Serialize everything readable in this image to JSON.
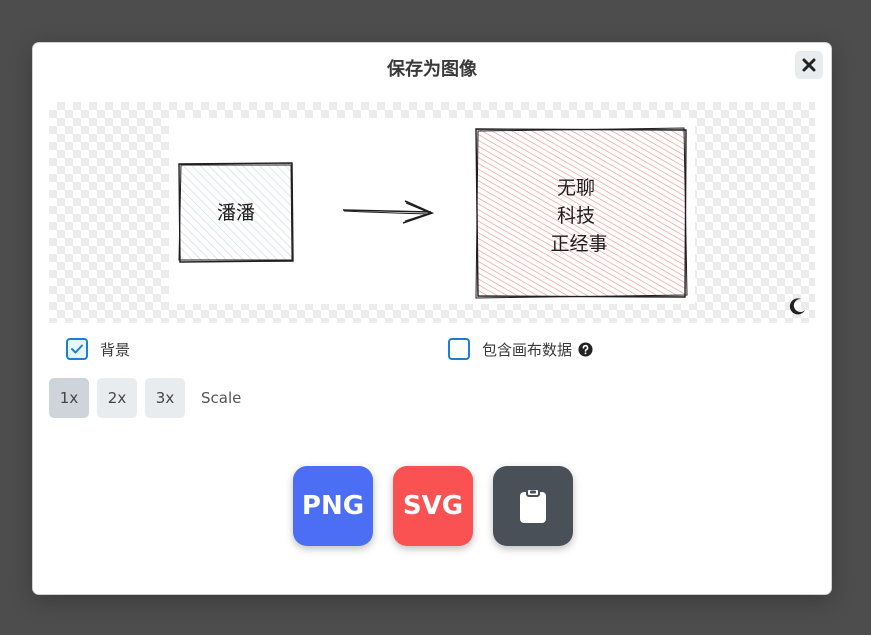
{
  "dialog": {
    "title": "保存为图像"
  },
  "canvas": {
    "left_box_text": "潘潘",
    "right_box_lines": [
      "无聊",
      "科技",
      "正经事"
    ]
  },
  "options": {
    "background_label": "背景",
    "background_checked": true,
    "embed_label": "包含画布数据",
    "embed_checked": false
  },
  "scale": {
    "options": [
      "1x",
      "2x",
      "3x"
    ],
    "selected": "1x",
    "label": "Scale"
  },
  "export": {
    "png_label": "PNG",
    "svg_label": "SVG",
    "png_color": "#4c6ef5",
    "svg_color": "#fa5252",
    "clipboard_color": "#495057"
  },
  "colors": {
    "accent": "#1c7ed6",
    "right_box_fill": "#ffc9c9",
    "left_box_fill": "#e9ecef"
  }
}
